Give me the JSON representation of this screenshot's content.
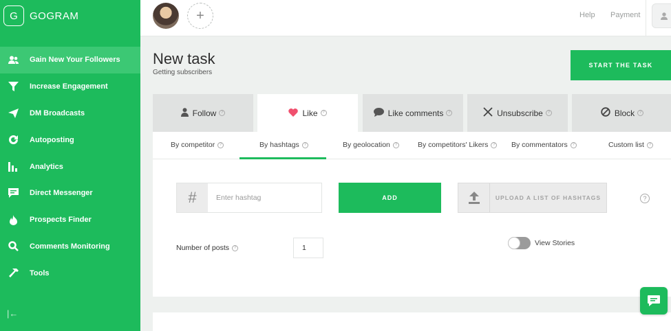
{
  "app": {
    "logo_letter": "G",
    "name": "GOGRAM"
  },
  "sidebar": {
    "items": [
      {
        "label": "Gain New Your Followers",
        "icon": "users-icon",
        "active": true
      },
      {
        "label": "Increase Engagement",
        "icon": "funnel-icon"
      },
      {
        "label": "DM Broadcasts",
        "icon": "send-icon"
      },
      {
        "label": "Autoposting",
        "icon": "refresh-icon"
      },
      {
        "label": "Analytics",
        "icon": "bar-chart-icon"
      },
      {
        "label": "Direct Messenger",
        "icon": "message-icon"
      },
      {
        "label": "Prospects Finder",
        "icon": "fire-icon"
      },
      {
        "label": "Comments Monitoring",
        "icon": "search-icon"
      },
      {
        "label": "Tools",
        "icon": "hammer-icon"
      }
    ],
    "collapse_icon": "collapse-icon"
  },
  "header": {
    "add_account": "+",
    "help": "Help",
    "payment": "Payment"
  },
  "page": {
    "title": "New task",
    "subtitle": "Getting subscribers",
    "start_button": "START THE TASK"
  },
  "tabs": [
    {
      "label": "Follow",
      "icon": "user-icon"
    },
    {
      "label": "Like",
      "icon": "heart-icon",
      "active": true
    },
    {
      "label": "Like comments",
      "icon": "comment-icon"
    },
    {
      "label": "Unsubscribe",
      "icon": "x-icon"
    },
    {
      "label": "Block",
      "icon": "ban-icon"
    }
  ],
  "subtabs": [
    {
      "label": "By competitor"
    },
    {
      "label": "By hashtags",
      "active": true
    },
    {
      "label": "By geolocation"
    },
    {
      "label": "By competitors' Likers"
    },
    {
      "label": "By commentators"
    },
    {
      "label": "Custom list"
    }
  ],
  "form": {
    "hashtag_placeholder": "Enter hashtag",
    "hashtag_symbol": "#",
    "add_button": "ADD",
    "upload_button": "UPLOAD A LIST OF HASHTAGS",
    "posts_label": "Number of posts",
    "posts_value": "1",
    "view_stories_label": "View Stories",
    "view_stories_on": false
  },
  "colors": {
    "brand": "#1dbb5c",
    "heart": "#f0506e"
  }
}
